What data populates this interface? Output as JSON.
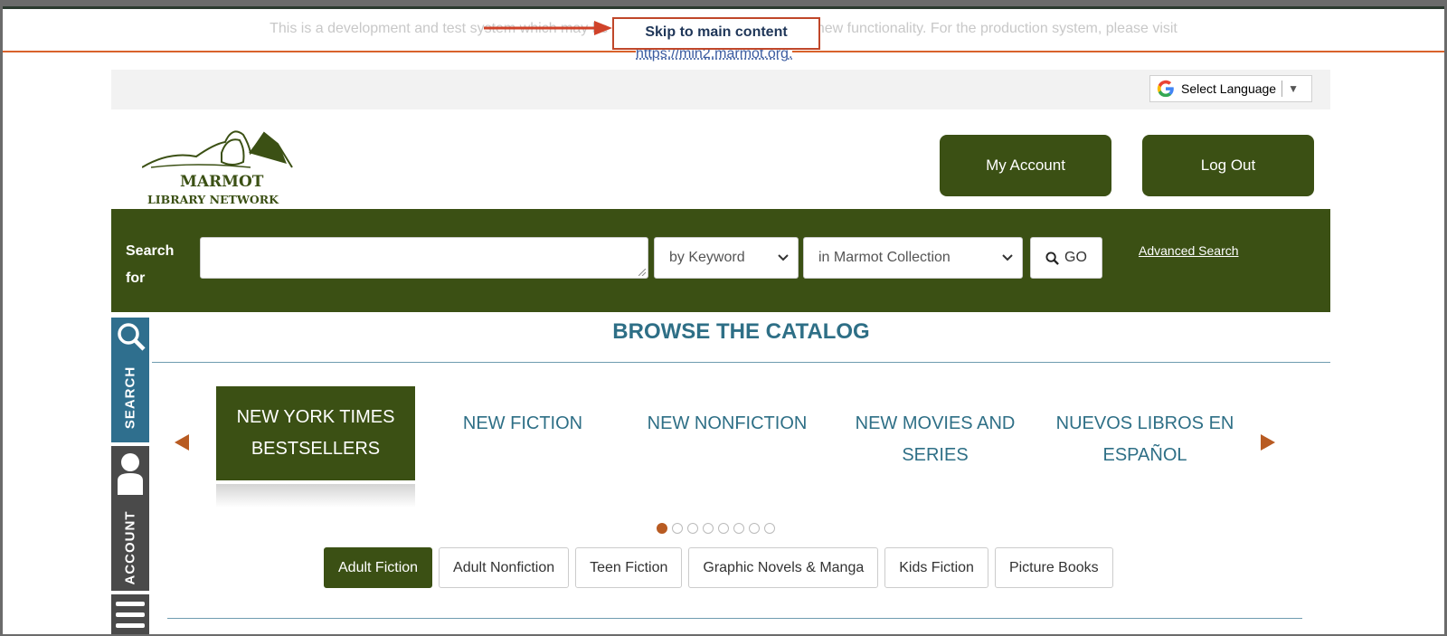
{
  "dev_banner": {
    "text": "This is a development and test system which may be unstable and is used for testing new functionality. For the production system, please visit",
    "link": "https://min2.marmot.org",
    "suffix": "."
  },
  "skip_link": "Skip to main content",
  "language": {
    "label": "Select Language",
    "caret": "▼"
  },
  "logo": {
    "line1": "MARMOT",
    "line2": "LIBRARY NETWORK"
  },
  "header": {
    "my_account": "My Account",
    "log_out": "Log Out"
  },
  "search": {
    "label": "Search for",
    "input_value": "",
    "type_selected": "by Keyword",
    "scope_selected": "in Marmot Collection",
    "go_label": "GO",
    "advanced": "Advanced Search"
  },
  "sidebar": {
    "search": "SEARCH",
    "account": "ACCOUNT"
  },
  "browse": {
    "title": "BROWSE THE CATALOG",
    "categories": [
      {
        "label": "NEW YORK TIMES BESTSELLERS"
      },
      {
        "label": "NEW FICTION"
      },
      {
        "label": "NEW NONFICTION"
      },
      {
        "label": "NEW MOVIES AND SERIES"
      },
      {
        "label": "NUEVOS LIBROS EN ESPAÑOL"
      }
    ],
    "active_category": 0,
    "page_count": 8,
    "current_page": 1,
    "subtabs": [
      "Adult Fiction",
      "Adult Nonfiction",
      "Teen Fiction",
      "Graphic Novels & Manga",
      "Kids Fiction",
      "Picture Books"
    ],
    "active_subtab": 0
  },
  "colors": {
    "brand_green": "#3b5014",
    "accent_teal": "#2e6f86",
    "accent_orange": "#b85b22",
    "annotation_red": "#c0472a"
  }
}
